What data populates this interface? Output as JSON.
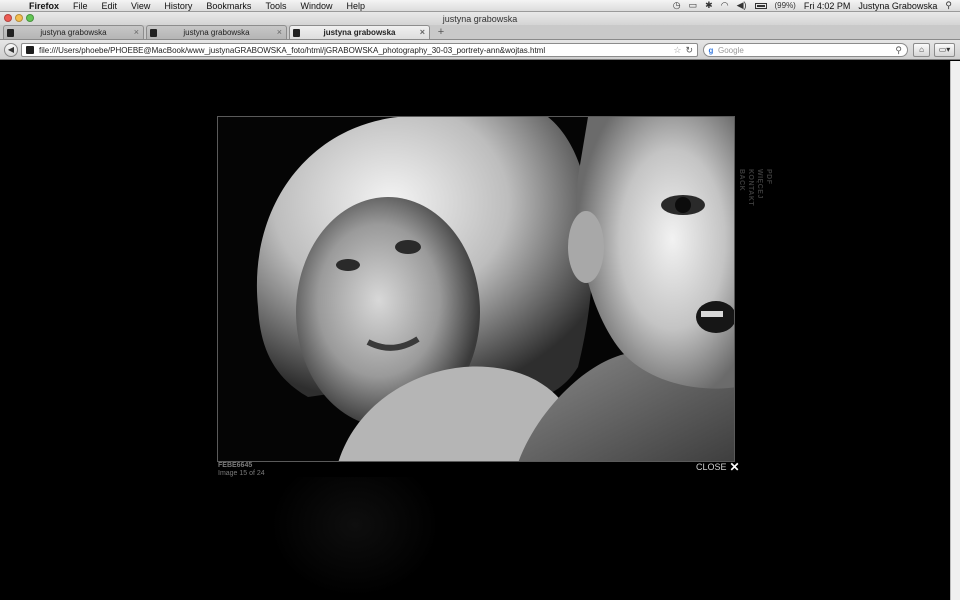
{
  "menubar": {
    "app_name": "Firefox",
    "menus": [
      "File",
      "Edit",
      "View",
      "History",
      "Bookmarks",
      "Tools",
      "Window",
      "Help"
    ],
    "battery_text": "(99%)",
    "clock": "Fri 4:02 PM",
    "user": "Justyna Grabowska"
  },
  "window": {
    "title": "justyna grabowska"
  },
  "tabs": [
    {
      "label": "justyna grabowska"
    },
    {
      "label": "justyna grabowska"
    },
    {
      "label": "justyna grabowska"
    }
  ],
  "navbar": {
    "url": "file:///Users/phoebe/PHOEBE@MacBook/www_justynaGRABOWSKA_foto/html/jGRABOWSKA_photography_30-03_portrety-ann&wojtas.html",
    "search_placeholder": "Google"
  },
  "lightbox": {
    "image_code": "FEBE6645",
    "image_counter": "Image 15 of 24",
    "close_label": "CLOSE",
    "side_links": [
      "BACK",
      "KONTAKT",
      "WIĘCEJ",
      "PDF"
    ]
  }
}
